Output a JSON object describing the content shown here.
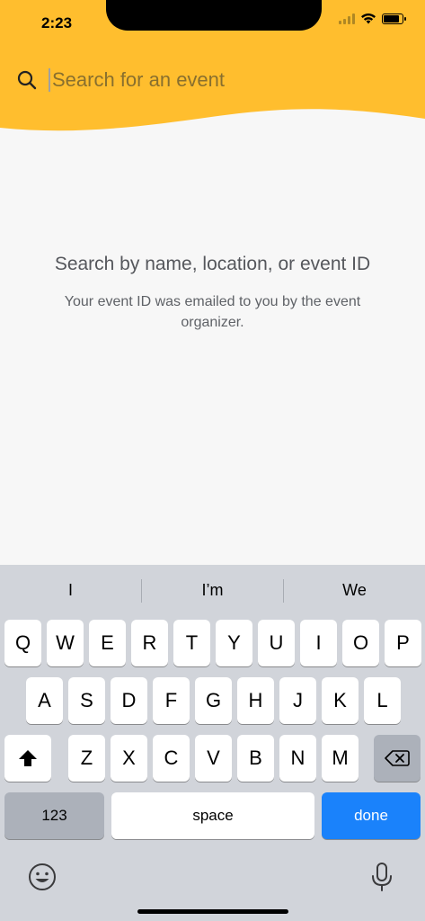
{
  "status_bar": {
    "time": "2:23"
  },
  "search": {
    "placeholder": "Search for an event"
  },
  "empty_state": {
    "title": "Search by name, location, or event ID",
    "subtitle": "Your event ID was emailed to you by the event organizer."
  },
  "keyboard": {
    "suggestions": [
      "I",
      "I’m",
      "We"
    ],
    "row1": [
      "Q",
      "W",
      "E",
      "R",
      "T",
      "Y",
      "U",
      "I",
      "O",
      "P"
    ],
    "row2": [
      "A",
      "S",
      "D",
      "F",
      "G",
      "H",
      "J",
      "K",
      "L"
    ],
    "row3": [
      "Z",
      "X",
      "C",
      "V",
      "B",
      "N",
      "M"
    ],
    "numbers_label": "123",
    "space_label": "space",
    "done_label": "done"
  },
  "colors": {
    "header": "#FFBE2E",
    "done": "#1A82FB"
  }
}
